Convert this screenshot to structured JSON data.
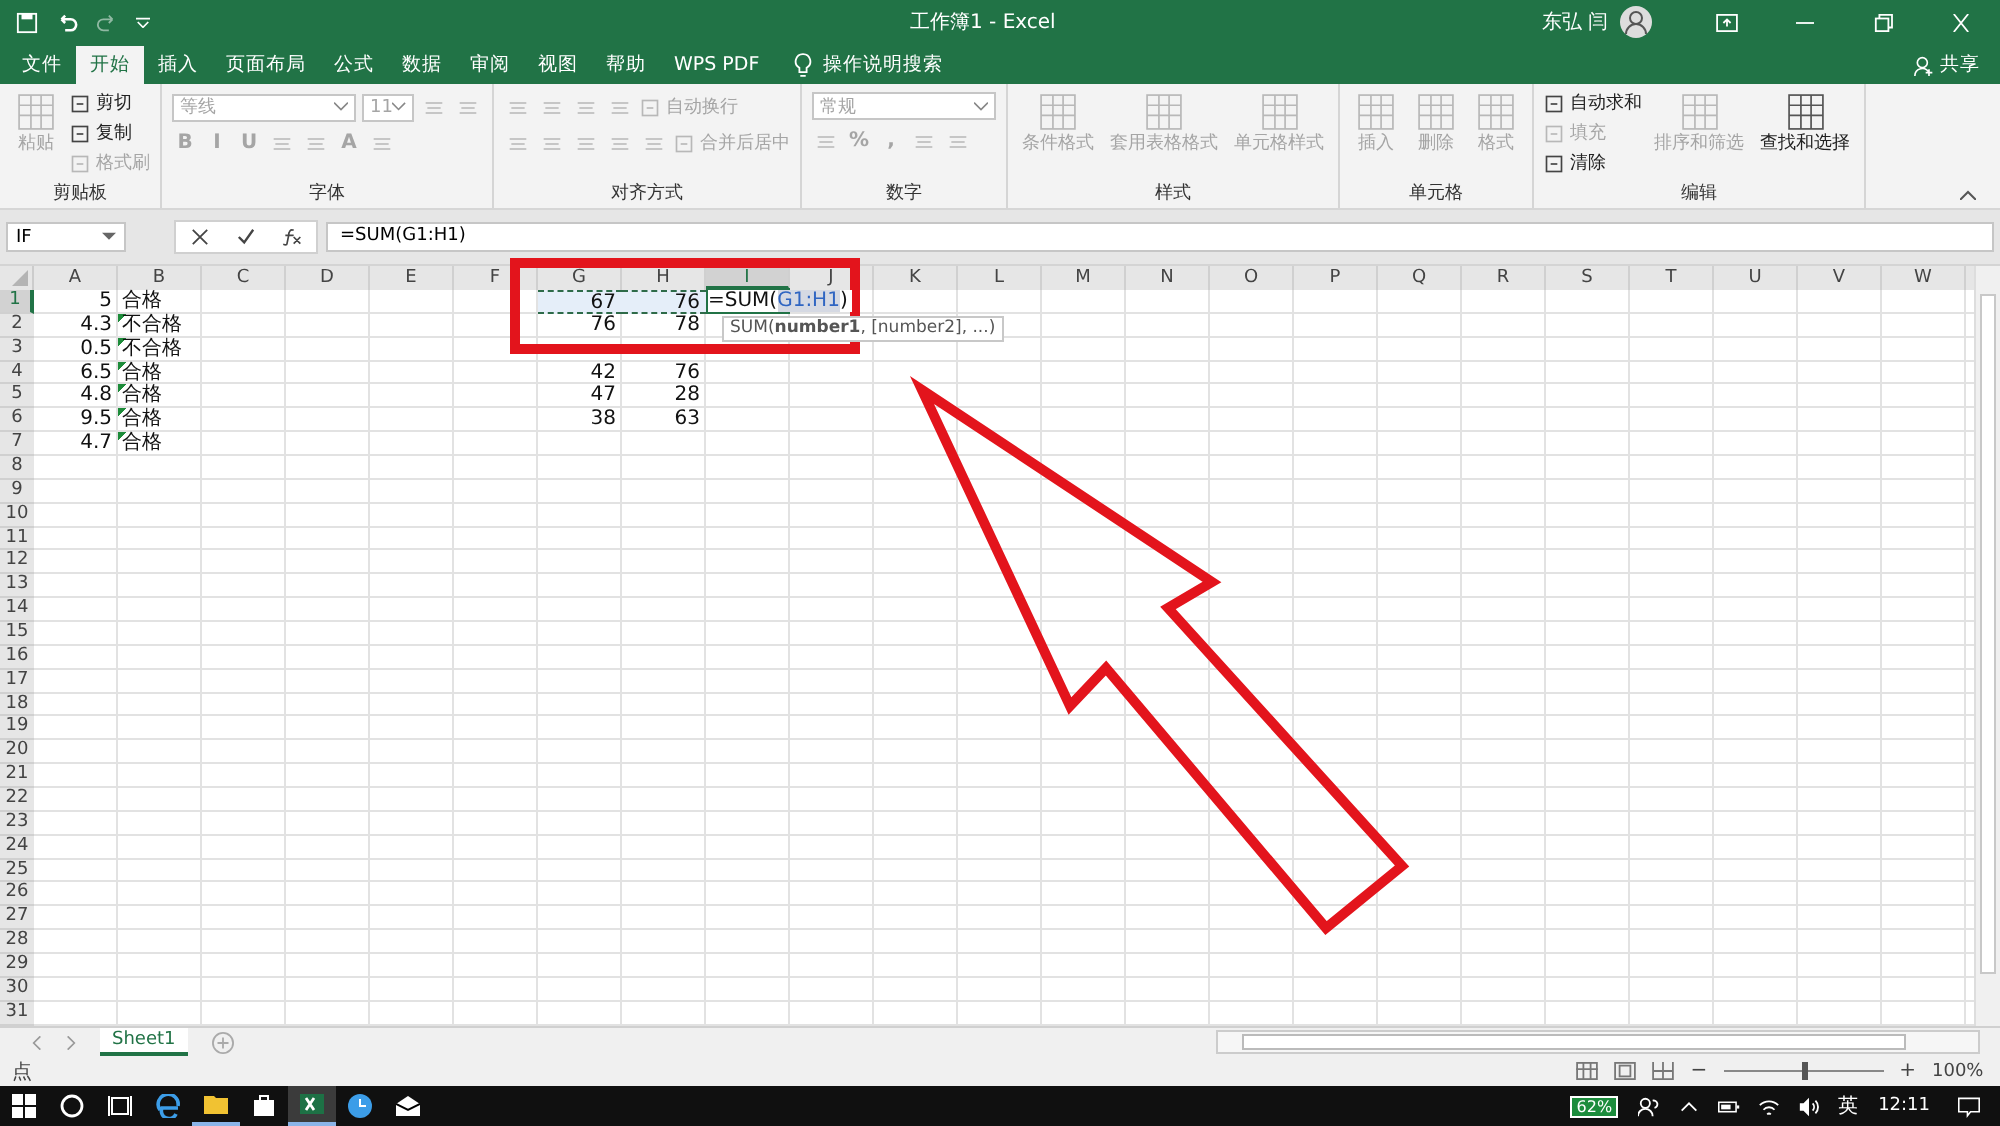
{
  "window": {
    "title": "工作簿1 - Excel",
    "user": "东弘 闫"
  },
  "tabs": [
    {
      "label": "文件",
      "selected": false
    },
    {
      "label": "开始",
      "selected": true
    },
    {
      "label": "插入",
      "selected": false
    },
    {
      "label": "页面布局",
      "selected": false
    },
    {
      "label": "公式",
      "selected": false
    },
    {
      "label": "数据",
      "selected": false
    },
    {
      "label": "审阅",
      "selected": false
    },
    {
      "label": "视图",
      "selected": false
    },
    {
      "label": "帮助",
      "selected": false
    },
    {
      "label": "WPS PDF",
      "selected": false
    }
  ],
  "search_hint": "操作说明搜索",
  "share": "共享",
  "ribbon": [
    {
      "label": "剪贴板",
      "columns": [
        [
          {
            "kind": "large",
            "label": "粘贴",
            "disabled": true
          }
        ],
        [
          {
            "kind": "small",
            "label": "剪切",
            "disabled": false
          },
          {
            "kind": "small",
            "label": "复制",
            "disabled": false
          },
          {
            "kind": "small",
            "label": "格式刷",
            "disabled": true
          }
        ]
      ]
    },
    {
      "label": "字体",
      "rows": [
        [
          {
            "kind": "field",
            "value": "等线",
            "wide": true,
            "disabled": true
          },
          {
            "kind": "field",
            "value": "11",
            "wide": false,
            "disabled": true
          },
          {
            "kind": "icon",
            "disabled": true
          },
          {
            "kind": "icon",
            "disabled": true
          }
        ],
        [
          {
            "kind": "glyph",
            "text": "B",
            "disabled": true
          },
          {
            "kind": "glyph",
            "text": "I",
            "disabled": true
          },
          {
            "kind": "glyph",
            "text": "U",
            "disabled": true
          },
          {
            "kind": "icon",
            "disabled": true
          },
          {
            "kind": "icon",
            "disabled": true
          },
          {
            "kind": "glyph",
            "text": "A",
            "disabled": true
          },
          {
            "kind": "icon",
            "disabled": true
          }
        ]
      ]
    },
    {
      "label": "对齐方式",
      "rows": [
        [
          {
            "kind": "icon",
            "disabled": true
          },
          {
            "kind": "icon",
            "disabled": true
          },
          {
            "kind": "icon",
            "disabled": true
          },
          {
            "kind": "icon",
            "disabled": true
          },
          {
            "kind": "small",
            "label": "自动换行",
            "disabled": true
          }
        ],
        [
          {
            "kind": "icon",
            "disabled": true
          },
          {
            "kind": "icon",
            "disabled": true
          },
          {
            "kind": "icon",
            "disabled": true
          },
          {
            "kind": "icon",
            "disabled": true
          },
          {
            "kind": "icon",
            "disabled": true
          },
          {
            "kind": "small",
            "label": "合并后居中",
            "disabled": true
          }
        ]
      ]
    },
    {
      "label": "数字",
      "rows": [
        [
          {
            "kind": "field",
            "value": "常规",
            "wide": true,
            "disabled": true
          }
        ],
        [
          {
            "kind": "icon",
            "disabled": true
          },
          {
            "kind": "glyph",
            "text": "%",
            "disabled": true
          },
          {
            "kind": "glyph",
            "text": ",",
            "disabled": true
          },
          {
            "kind": "icon",
            "disabled": true
          },
          {
            "kind": "icon",
            "disabled": true
          }
        ]
      ]
    },
    {
      "label": "样式",
      "columns": [
        [
          {
            "kind": "large",
            "label": "条件格式",
            "disabled": true
          }
        ],
        [
          {
            "kind": "large",
            "label": "套用表格格式",
            "disabled": true
          }
        ],
        [
          {
            "kind": "large",
            "label": "单元格样式",
            "disabled": true
          }
        ]
      ]
    },
    {
      "label": "单元格",
      "columns": [
        [
          {
            "kind": "large",
            "label": "插入",
            "disabled": true
          }
        ],
        [
          {
            "kind": "large",
            "label": "删除",
            "disabled": true
          }
        ],
        [
          {
            "kind": "large",
            "label": "格式",
            "disabled": true
          }
        ]
      ]
    },
    {
      "label": "编辑",
      "columns": [
        [
          {
            "kind": "small",
            "label": "自动求和",
            "disabled": false
          },
          {
            "kind": "small",
            "label": "填充",
            "disabled": true
          },
          {
            "kind": "small",
            "label": "清除",
            "disabled": false
          }
        ],
        [
          {
            "kind": "large",
            "label": "排序和筛选",
            "disabled": true
          }
        ],
        [
          {
            "kind": "large",
            "label": "查找和选择",
            "disabled": false
          }
        ]
      ]
    }
  ],
  "formula_bar": {
    "name_box": "IF",
    "formula": "=SUM(G1:H1)"
  },
  "columns": [
    {
      "label": "A",
      "selected": false
    },
    {
      "label": "B",
      "selected": false
    },
    {
      "label": "C",
      "selected": false
    },
    {
      "label": "D",
      "selected": false
    },
    {
      "label": "E",
      "selected": false
    },
    {
      "label": "F",
      "selected": false
    },
    {
      "label": "G",
      "selected": false
    },
    {
      "label": "H",
      "selected": false
    },
    {
      "label": "I",
      "selected": true
    },
    {
      "label": "J",
      "selected": false
    },
    {
      "label": "K",
      "selected": false
    },
    {
      "label": "L",
      "selected": false
    },
    {
      "label": "M",
      "selected": false
    },
    {
      "label": "N",
      "selected": false
    },
    {
      "label": "O",
      "selected": false
    },
    {
      "label": "P",
      "selected": false
    },
    {
      "label": "Q",
      "selected": false
    },
    {
      "label": "R",
      "selected": false
    },
    {
      "label": "S",
      "selected": false
    },
    {
      "label": "T",
      "selected": false
    },
    {
      "label": "U",
      "selected": false
    },
    {
      "label": "V",
      "selected": false
    },
    {
      "label": "W",
      "selected": false
    }
  ],
  "rows": [
    {
      "label": "1",
      "selected": true,
      "cells": {
        "A": {
          "kind": "number",
          "text": "5"
        },
        "B": {
          "kind": "text",
          "text": "合格",
          "flag": false
        },
        "G": {
          "kind": "number",
          "text": "67",
          "in_range": true
        },
        "H": {
          "kind": "number",
          "text": "76",
          "in_range": true
        },
        "I": {
          "kind": "formula",
          "before": "=SUM(",
          "reference": "G1:H1",
          "after": ")"
        }
      }
    },
    {
      "label": "2",
      "selected": false,
      "cells": {
        "A": {
          "kind": "number",
          "text": "4.3"
        },
        "B": {
          "kind": "text",
          "text": "不合格",
          "flag": true
        },
        "G": {
          "kind": "number",
          "text": "76",
          "in_range": false
        },
        "H": {
          "kind": "number",
          "text": "78",
          "in_range": false
        }
      }
    },
    {
      "label": "3",
      "selected": false,
      "cells": {
        "A": {
          "kind": "number",
          "text": "0.5"
        },
        "B": {
          "kind": "text",
          "text": "不合格",
          "flag": true
        }
      }
    },
    {
      "label": "4",
      "selected": false,
      "cells": {
        "A": {
          "kind": "number",
          "text": "6.5"
        },
        "B": {
          "kind": "text",
          "text": "合格",
          "flag": true
        },
        "G": {
          "kind": "number",
          "text": "42",
          "in_range": false
        },
        "H": {
          "kind": "number",
          "text": "76",
          "in_range": false
        }
      }
    },
    {
      "label": "5",
      "selected": false,
      "cells": {
        "A": {
          "kind": "number",
          "text": "4.8"
        },
        "B": {
          "kind": "text",
          "text": "合格",
          "flag": true
        },
        "G": {
          "kind": "number",
          "text": "47",
          "in_range": false
        },
        "H": {
          "kind": "number",
          "text": "28",
          "in_range": false
        }
      }
    },
    {
      "label": "6",
      "selected": false,
      "cells": {
        "A": {
          "kind": "number",
          "text": "9.5"
        },
        "B": {
          "kind": "text",
          "text": "合格",
          "flag": true
        },
        "G": {
          "kind": "number",
          "text": "38",
          "in_range": false
        },
        "H": {
          "kind": "number",
          "text": "63",
          "in_range": false
        }
      }
    },
    {
      "label": "7",
      "selected": false,
      "cells": {
        "A": {
          "kind": "number",
          "text": "4.7"
        },
        "B": {
          "kind": "text",
          "text": "合格",
          "flag": true
        }
      }
    },
    {
      "label": "8",
      "selected": false
    },
    {
      "label": "9",
      "selected": false
    },
    {
      "label": "10",
      "selected": false
    },
    {
      "label": "11",
      "selected": false
    },
    {
      "label": "12",
      "selected": false
    },
    {
      "label": "13",
      "selected": false
    },
    {
      "label": "14",
      "selected": false
    },
    {
      "label": "15",
      "selected": false
    },
    {
      "label": "16",
      "selected": false
    },
    {
      "label": "17",
      "selected": false
    },
    {
      "label": "18",
      "selected": false
    },
    {
      "label": "19",
      "selected": false
    },
    {
      "label": "20",
      "selected": false
    },
    {
      "label": "21",
      "selected": false
    },
    {
      "label": "22",
      "selected": false
    },
    {
      "label": "23",
      "selected": false
    },
    {
      "label": "24",
      "selected": false
    },
    {
      "label": "25",
      "selected": false
    },
    {
      "label": "26",
      "selected": false
    },
    {
      "label": "27",
      "selected": false
    },
    {
      "label": "28",
      "selected": false
    },
    {
      "label": "29",
      "selected": false
    },
    {
      "label": "30",
      "selected": false
    },
    {
      "label": "31",
      "selected": false
    }
  ],
  "tooltip": "SUM(**number1**, [number2], ...)",
  "sheets": [
    {
      "label": "Sheet1",
      "selected": true
    }
  ],
  "status_bar": {
    "mode": "点",
    "zoom_out": "−",
    "zoom_in": "+",
    "zoom": {
      "level": 0.5,
      "reading": "100%"
    }
  },
  "taskbar": {
    "apps": [
      {
        "running": false,
        "selected": false
      },
      {
        "running": false,
        "selected": false
      },
      {
        "running": false,
        "selected": false
      },
      {
        "running": false,
        "selected": false
      },
      {
        "running": true,
        "selected": false
      },
      {
        "running": false,
        "selected": false
      },
      {
        "running": true,
        "selected": true
      }
    ],
    "battery": "62%",
    "ime": "英",
    "clock": "12:11"
  }
}
